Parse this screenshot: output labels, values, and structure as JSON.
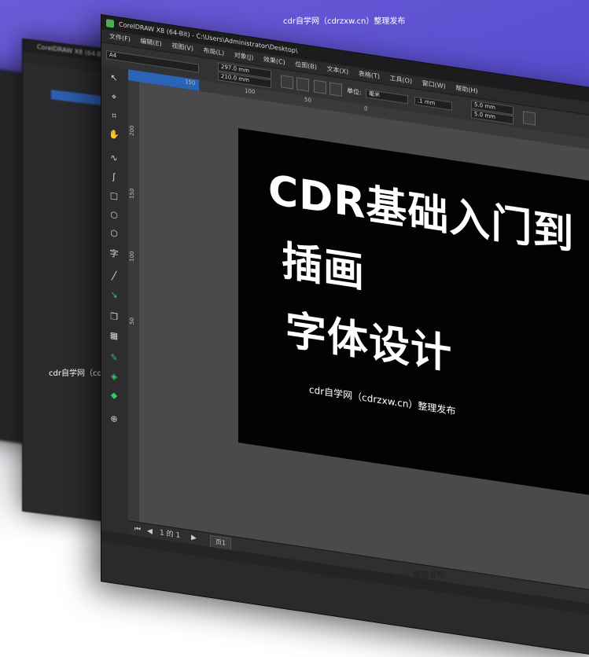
{
  "window": {
    "title": "CorelDRAW X8 (64-Bit) - C:\\Users\\Administrator\\Desktop\\",
    "back_title": "CorelDRAW X8 (64-Bit)"
  },
  "menu": [
    "文件(F)",
    "编辑(E)",
    "视图(V)",
    "布局(L)",
    "对象(J)",
    "效果(C)",
    "位图(B)",
    "文本(X)",
    "表格(T)",
    "工具(O)",
    "窗口(W)",
    "帮助(H)"
  ],
  "propbar": {
    "paper": "A4",
    "width": "297.0 mm",
    "height": "210.0 mm",
    "units_label": "单位:",
    "units_value": "毫米",
    "nudge": ".1 mm",
    "dup_x": "5.0 mm",
    "dup_y": "5.0 mm"
  },
  "ruler": {
    "top": [
      "150",
      "100",
      "50",
      "0"
    ],
    "left": [
      "200",
      "150",
      "100",
      "50"
    ]
  },
  "artboard": {
    "line1": "CDR基础入门到",
    "line2": "插画",
    "line3": "字体设计"
  },
  "statusbar": {
    "page_indicator": "1 的 1",
    "page_tab": "页1"
  },
  "watermarks": {
    "top": "cdr自学网（cdrzxw.cn）整理发布",
    "left": "cdr自学网（cdrzxw.cn）整理发布",
    "page": "cdr自学网（cdrzxw.cn）整理发布",
    "bottom": "cdr自学网（cdrzxw.cn）整理发布"
  },
  "colors": {
    "accent_blue": "#2a63b7",
    "tool_green": "#3cc46a",
    "background_purple": "#5a4fd0"
  }
}
